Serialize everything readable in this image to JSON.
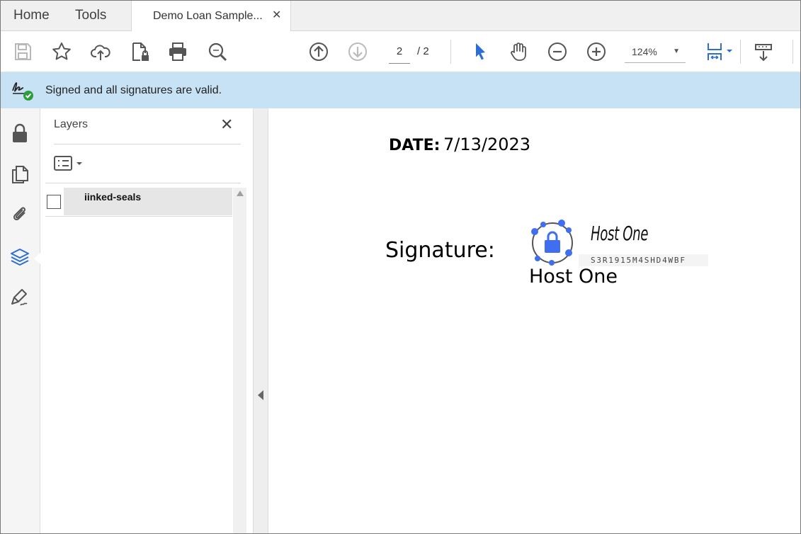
{
  "tabbar": {
    "home_label": "Home",
    "tools_label": "Tools",
    "document_tab_title": "Demo Loan Sample...",
    "close_glyph": "✕"
  },
  "toolbar": {
    "icons": [
      "save-icon",
      "bookmark-star-icon",
      "cloud-upload-icon",
      "file-lock-icon",
      "print-icon",
      "search-zoom-icon",
      "page-up-icon",
      "page-down-icon",
      "select-cursor-icon",
      "hand-tool-icon",
      "zoom-out-icon",
      "zoom-in-icon",
      "fit-page-icon",
      "read-mode-icon"
    ],
    "current_page": "2",
    "page_separator": "/ 2",
    "zoom": "124%",
    "accent_color": "#2d6fd1"
  },
  "signature_bar": {
    "message": "Signed and all signatures are valid.",
    "status_color": "#2e9b3e",
    "background": "#c8e2f5"
  },
  "rail": {
    "items": [
      "lock-icon",
      "pages-icon",
      "attachment-icon",
      "layers-icon",
      "signature-pen-icon"
    ],
    "active": "layers-icon"
  },
  "layers_panel": {
    "title": "Layers",
    "close_glyph": "✕",
    "layers": [
      {
        "label": "iinked-seals",
        "checked": false
      }
    ]
  },
  "document": {
    "date_label": "DATE:",
    "date_value": "7/13/2023",
    "signature_label": "Signature:",
    "signature_script": "Host One",
    "signature_code": "S3R1915M4SHD4WBF",
    "signer_name": "Host One",
    "seal_color": "#3f6ef0"
  }
}
